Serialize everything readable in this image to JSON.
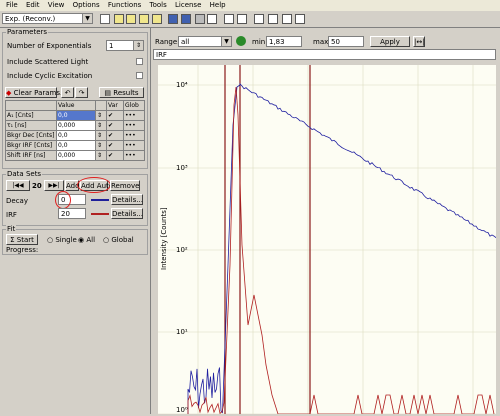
{
  "menu": [
    "File",
    "Edit",
    "View",
    "Options",
    "Functions",
    "Tools",
    "License",
    "Help"
  ],
  "toolbar": {
    "model_select": "Exp. (Reconv.)"
  },
  "parameters": {
    "title": "Parameters",
    "num_exponentials_label": "Number of Exponentials",
    "num_exponentials_value": "1",
    "scattered_light_label": "Include Scattered Light",
    "cyclic_excitation_label": "Include Cyclic Excitation",
    "clear_params_label": "Clear Params.",
    "results_label": "Results",
    "table_headers": [
      "",
      "Value",
      "",
      "Var",
      "Glob"
    ],
    "rows": [
      {
        "name": "A₁ [Cnts]",
        "value": "0,0",
        "var": "✔",
        "glob": "•••"
      },
      {
        "name": "τ₁ [ns]",
        "value": "0,000",
        "var": "✔",
        "glob": "•••"
      },
      {
        "name": "Bkgr Dec [Cnts]",
        "value": "0,0",
        "var": "✔",
        "glob": "•••"
      },
      {
        "name": "Bkgr IRF [Cnts]",
        "value": "0,0",
        "var": "✔",
        "glob": "•••"
      },
      {
        "name": "Shift IRF [ns]",
        "value": "0,000",
        "var": "✔",
        "glob": "•••"
      }
    ]
  },
  "datasets": {
    "title": "Data Sets",
    "index": "20",
    "add_label": "Add",
    "add_auto_label": "Add Auto",
    "remove_label": "Remove",
    "decay_label": "Decay",
    "decay_value": "0",
    "irf_label": "IRF",
    "irf_value": "20",
    "details_label": "Details..."
  },
  "fit": {
    "title": "Fit",
    "start_label": "Start",
    "single_label": "Single",
    "all_label": "All",
    "global_label": "Global",
    "progress_label": "Progress:"
  },
  "range": {
    "label": "Range:",
    "value": "all",
    "min_label": "min:",
    "min_value": "1,83",
    "max_label": "max:",
    "max_value": "50",
    "apply_label": "Apply",
    "sub_label": "IRF"
  },
  "chart_data": {
    "type": "line",
    "ylabel": "Intensity [Counts]",
    "yscale": "log",
    "ytick_labels": [
      "10⁴",
      "10³",
      "10²",
      "10¹",
      "10⁰"
    ],
    "series": [
      {
        "name": "Decay",
        "color": "#1f1fa0"
      },
      {
        "name": "IRF",
        "color": "#b02020"
      }
    ],
    "markers": [
      "min",
      "peak",
      "max"
    ]
  }
}
